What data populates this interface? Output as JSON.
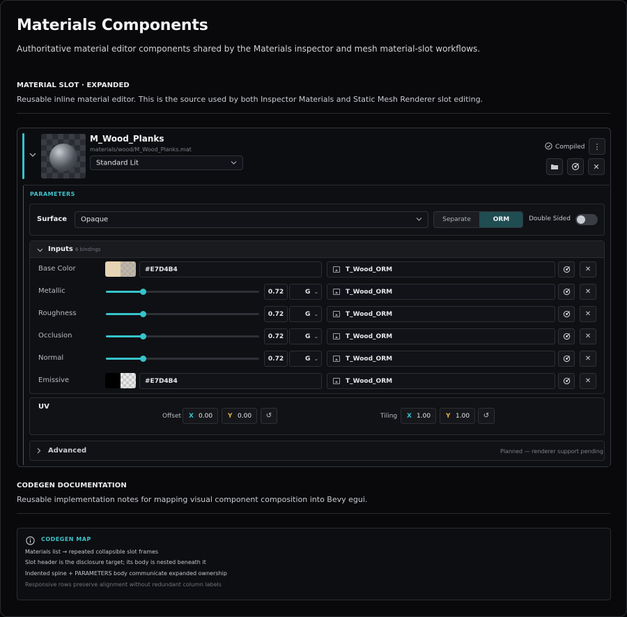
{
  "page": {
    "title": "Materials Components",
    "lead": "Authoritative material editor components shared by the Materials inspector and mesh material-slot workflows."
  },
  "slot_section": {
    "title": "MATERIAL SLOT · EXPANDED",
    "desc": "Reusable inline material editor. This is the source used by both Inspector Materials and Static Mesh Renderer slot editing."
  },
  "slot": {
    "name": "M_Wood_Planks",
    "path": "materials/wood/M_Wood_Planks.mat",
    "shader": "Standard Lit",
    "status": "Compiled",
    "parameters_label": "PARAMETERS"
  },
  "surface": {
    "label": "Surface",
    "mode": "Opaque",
    "seg_left": "Separate",
    "seg_right": "ORM",
    "double_sided_label": "Double Sided",
    "double_sided": false
  },
  "inputs": {
    "title": "Inputs",
    "count": "6 bindings",
    "rows": [
      {
        "label": "Base Color",
        "kind": "color",
        "value": "#E7D4B4",
        "texture": "T_Wood_ORM"
      },
      {
        "label": "Metallic",
        "kind": "scalar",
        "value": "0.72",
        "fraction": 0.24,
        "channel": "G",
        "texture": "T_Wood_ORM"
      },
      {
        "label": "Roughness",
        "kind": "scalar",
        "value": "0.72",
        "fraction": 0.24,
        "channel": "G",
        "texture": "T_Wood_ORM"
      },
      {
        "label": "Occlusion",
        "kind": "scalar",
        "value": "0.72",
        "fraction": 0.24,
        "channel": "G",
        "texture": "T_Wood_ORM"
      },
      {
        "label": "Normal",
        "kind": "scalar",
        "value": "0.72",
        "fraction": 0.24,
        "channel": "G",
        "texture": "T_Wood_ORM"
      },
      {
        "label": "Emissive",
        "kind": "color",
        "value": "#E7D4B4",
        "texture": "T_Wood_ORM"
      }
    ]
  },
  "uv": {
    "title": "UV",
    "offset_label": "Offset",
    "offset_x": "0.00",
    "offset_y": "0.00",
    "tiling_label": "Tiling",
    "tiling_x": "1.00",
    "tiling_y": "1.00",
    "x_axis": "X",
    "y_axis": "Y"
  },
  "advanced": {
    "title": "Advanced",
    "note": "Planned — renderer support pending"
  },
  "codegen_section": {
    "title": "CODEGEN DOCUMENTATION",
    "desc": "Reusable implementation notes for mapping visual component composition into Bevy egui."
  },
  "codegen_map": {
    "title": "CODEGEN MAP",
    "lines": [
      "Materials list → repeated collapsible slot frames",
      "Slot header is the disclosure target; its body is nested beneath it",
      "Indented spine + PARAMETERS body communicate expanded ownership",
      "Responsive rows preserve alignment without redundant column labels"
    ]
  },
  "colors": {
    "accent": "#35c4cc",
    "base_color": "#E7D4B4",
    "background": "#09090b",
    "x_axis": "#35c4cc",
    "y_axis": "#e0b441"
  }
}
